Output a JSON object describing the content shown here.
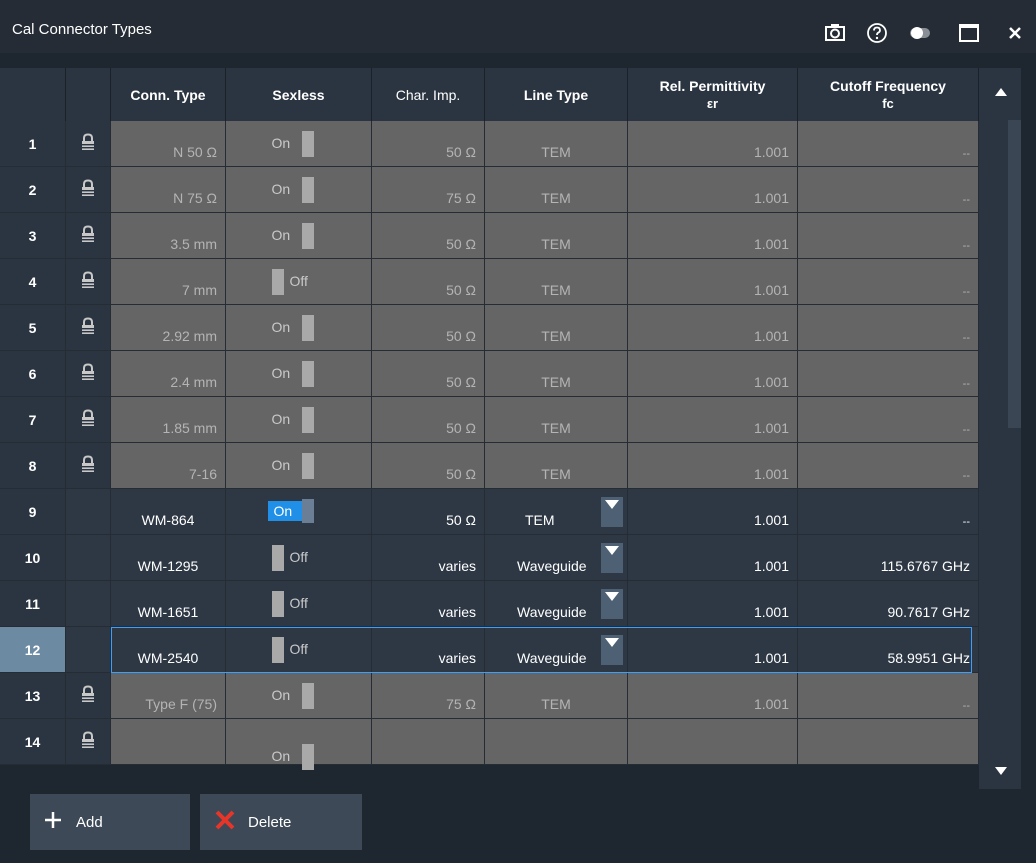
{
  "window": {
    "title": "Cal Connector Types"
  },
  "titlebar_icons": [
    "camera-icon",
    "help-icon",
    "toggle-display-icon",
    "maximize-icon",
    "close-icon"
  ],
  "columns": {
    "conn_type": "Conn. Type",
    "sexless": "Sexless",
    "char_imp": "Char. Imp.",
    "line_type": "Line Type",
    "rel_perm": "Rel. Permittivity",
    "rel_perm_sub": "εr",
    "cutoff": "Cutoff Frequency",
    "cutoff_sub": "fc"
  },
  "rows": [
    {
      "n": "1",
      "locked": true,
      "conn": "N 50 Ω",
      "sexless": "On",
      "imp": "50 Ω",
      "line": "TEM",
      "perm": "1.001",
      "fc": "--"
    },
    {
      "n": "2",
      "locked": true,
      "conn": "N 75 Ω",
      "sexless": "On",
      "imp": "75 Ω",
      "line": "TEM",
      "perm": "1.001",
      "fc": "--"
    },
    {
      "n": "3",
      "locked": true,
      "conn": "3.5 mm",
      "sexless": "On",
      "imp": "50 Ω",
      "line": "TEM",
      "perm": "1.001",
      "fc": "--"
    },
    {
      "n": "4",
      "locked": true,
      "conn": "7 mm",
      "sexless": "Off",
      "imp": "50 Ω",
      "line": "TEM",
      "perm": "1.001",
      "fc": "--"
    },
    {
      "n": "5",
      "locked": true,
      "conn": "2.92 mm",
      "sexless": "On",
      "imp": "50 Ω",
      "line": "TEM",
      "perm": "1.001",
      "fc": "--"
    },
    {
      "n": "6",
      "locked": true,
      "conn": "2.4 mm",
      "sexless": "On",
      "imp": "50 Ω",
      "line": "TEM",
      "perm": "1.001",
      "fc": "--"
    },
    {
      "n": "7",
      "locked": true,
      "conn": "1.85 mm",
      "sexless": "On",
      "imp": "50 Ω",
      "line": "TEM",
      "perm": "1.001",
      "fc": "--"
    },
    {
      "n": "8",
      "locked": true,
      "conn": "7-16",
      "sexless": "On",
      "imp": "50 Ω",
      "line": "TEM",
      "perm": "1.001",
      "fc": "--"
    },
    {
      "n": "9",
      "locked": false,
      "conn": "WM-864",
      "sexless": "On",
      "imp": "50 Ω",
      "line": "TEM",
      "perm": "1.001",
      "fc": "--"
    },
    {
      "n": "10",
      "locked": false,
      "conn": "WM-1295",
      "sexless": "Off",
      "imp": "varies",
      "line": "Waveguide",
      "perm": "1.001",
      "fc": "115.6767 GHz"
    },
    {
      "n": "11",
      "locked": false,
      "conn": "WM-1651",
      "sexless": "Off",
      "imp": "varies",
      "line": "Waveguide",
      "perm": "1.001",
      "fc": "90.7617 GHz"
    },
    {
      "n": "12",
      "locked": false,
      "conn": "WM-2540",
      "sexless": "Off",
      "imp": "varies",
      "line": "Waveguide",
      "perm": "1.001",
      "fc": "58.9951 GHz"
    },
    {
      "n": "13",
      "locked": true,
      "conn": "Type F (75)",
      "sexless": "On",
      "imp": "75 Ω",
      "line": "TEM",
      "perm": "1.001",
      "fc": "--"
    },
    {
      "n": "14",
      "locked": true,
      "conn": "",
      "sexless": "On",
      "imp": "",
      "line": "",
      "perm": "",
      "fc": ""
    }
  ],
  "footer": {
    "add_label": "Add",
    "delete_label": "Delete"
  },
  "colors": {
    "accent": "#1f8fe8",
    "delete_red": "#e8352a"
  }
}
